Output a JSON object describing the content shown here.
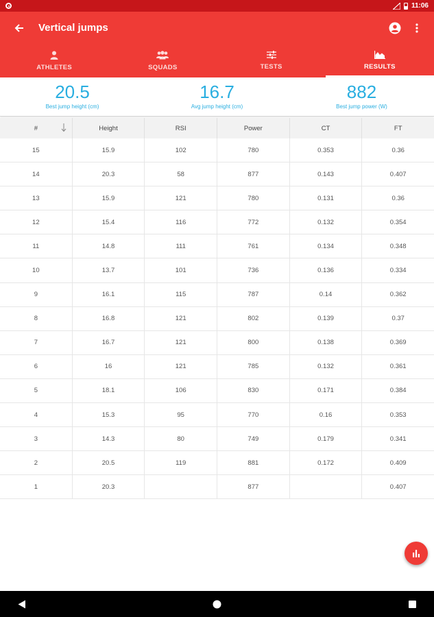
{
  "status_bar": {
    "time": "11:06"
  },
  "toolbar": {
    "title": "Vertical jumps"
  },
  "tabs": [
    {
      "label": "ATHLETES",
      "icon": "person-icon"
    },
    {
      "label": "SQUADS",
      "icon": "group-icon"
    },
    {
      "label": "TESTS",
      "icon": "tune-icon"
    },
    {
      "label": "RESULTS",
      "icon": "area-chart-icon",
      "active": true
    }
  ],
  "stats": [
    {
      "value": "20.5",
      "label": "Best jump height (cm)"
    },
    {
      "value": "16.7",
      "label": "Avg jump height (cm)"
    },
    {
      "value": "882",
      "label": "Best jump power (W)"
    }
  ],
  "table": {
    "columns": [
      "#",
      "Height",
      "RSI",
      "Power",
      "CT",
      "FT"
    ],
    "rows": [
      [
        "15",
        "15.9",
        "102",
        "780",
        "0.353",
        "0.36"
      ],
      [
        "14",
        "20.3",
        "58",
        "877",
        "0.143",
        "0.407"
      ],
      [
        "13",
        "15.9",
        "121",
        "780",
        "0.131",
        "0.36"
      ],
      [
        "12",
        "15.4",
        "116",
        "772",
        "0.132",
        "0.354"
      ],
      [
        "11",
        "14.8",
        "111",
        "761",
        "0.134",
        "0.348"
      ],
      [
        "10",
        "13.7",
        "101",
        "736",
        "0.136",
        "0.334"
      ],
      [
        "9",
        "16.1",
        "115",
        "787",
        "0.14",
        "0.362"
      ],
      [
        "8",
        "16.8",
        "121",
        "802",
        "0.139",
        "0.37"
      ],
      [
        "7",
        "16.7",
        "121",
        "800",
        "0.138",
        "0.369"
      ],
      [
        "6",
        "16",
        "121",
        "785",
        "0.132",
        "0.361"
      ],
      [
        "5",
        "18.1",
        "106",
        "830",
        "0.171",
        "0.384"
      ],
      [
        "4",
        "15.3",
        "95",
        "770",
        "0.16",
        "0.353"
      ],
      [
        "3",
        "14.3",
        "80",
        "749",
        "0.179",
        "0.341"
      ],
      [
        "2",
        "20.5",
        "119",
        "881",
        "0.172",
        "0.409"
      ],
      [
        "1",
        "20.3",
        "",
        "877",
        "",
        "0.407"
      ]
    ]
  },
  "colors": {
    "primary": "#ef3b36",
    "status_bar": "#c6161a",
    "accent_blue": "#29aee0"
  }
}
